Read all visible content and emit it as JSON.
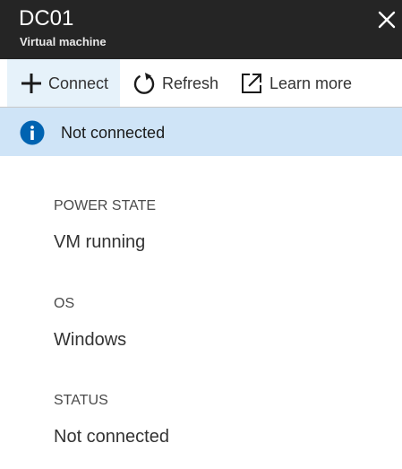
{
  "header": {
    "title": "DC01",
    "subtitle": "Virtual machine",
    "close_icon": "close-icon"
  },
  "toolbar": {
    "connect_label": "Connect",
    "connect_icon": "plus-icon",
    "refresh_label": "Refresh",
    "refresh_icon": "refresh-icon",
    "learn_more_label": "Learn more",
    "learn_more_icon": "external-link-icon"
  },
  "banner": {
    "text": "Not connected",
    "icon": "info-icon",
    "background_color": "#cfe4f7",
    "icon_color": "#0063b1"
  },
  "properties": [
    {
      "label": "POWER STATE",
      "value": "VM running"
    },
    {
      "label": "OS",
      "value": "Windows"
    },
    {
      "label": "STATUS",
      "value": "Not connected"
    }
  ],
  "colors": {
    "header_bg": "#252525",
    "accent": "#0063b1",
    "active_button_bg": "#e6f2fa"
  }
}
